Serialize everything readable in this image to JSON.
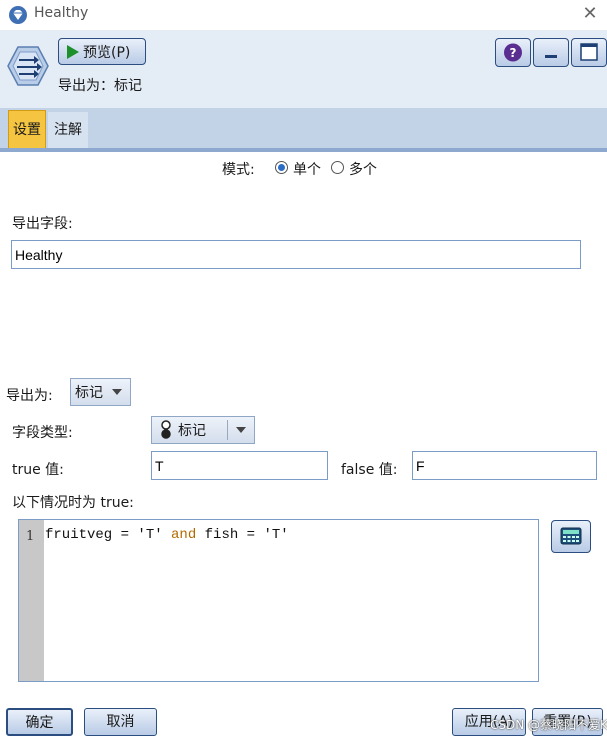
{
  "window": {
    "title": "Healthy"
  },
  "toolbar": {
    "preview_label": "预览(P)",
    "export_as": "导出为：标记"
  },
  "tabs": [
    {
      "label": "设置",
      "active": true
    },
    {
      "label": "注解",
      "active": false
    }
  ],
  "mode": {
    "label": "模式:",
    "options": [
      {
        "label": "单个",
        "selected": true
      },
      {
        "label": "多个",
        "selected": false
      }
    ]
  },
  "derive_field": {
    "label": "导出字段:",
    "value": "Healthy"
  },
  "derive_as": {
    "label": "导出为:",
    "value": "标记"
  },
  "field_type": {
    "label": "字段类型:",
    "value": "标记"
  },
  "true_value": {
    "label": "true 值:",
    "value": "T"
  },
  "false_value": {
    "label": "false 值:",
    "value": "F"
  },
  "condition": {
    "label": "以下情况时为 true:",
    "line_number": "1",
    "code_before": "fruitveg = 'T' ",
    "code_keyword": "and",
    "code_after": " fish = 'T'"
  },
  "buttons": {
    "ok": "确定",
    "cancel": "取消",
    "apply": "应用(A)",
    "reset": "重置(R)"
  },
  "watermark": "CSDN @蔡晓阳不爱Kyo",
  "icons": {
    "app": "gem-icon",
    "close": "close-icon",
    "node": "derive-node-icon",
    "preview": "play-icon",
    "help": "help-icon",
    "minimize": "minimize-icon",
    "maximize": "maximize-icon",
    "field_type": "flag-type-icon",
    "expr_builder": "calculator-icon"
  },
  "colors": {
    "header_bg": "#e4ecf6",
    "tab_active": "#f5c542",
    "tabstrip": "#c2d3e8",
    "radio_selected": "#2b6cc4"
  }
}
